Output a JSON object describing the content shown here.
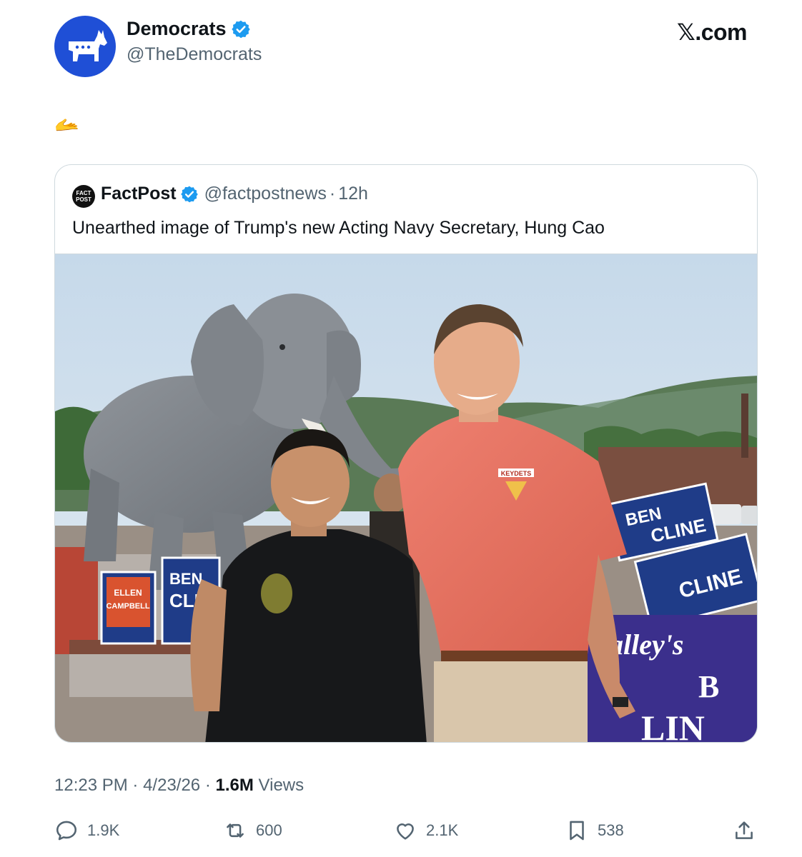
{
  "author": {
    "name": "Democrats",
    "handle": "@TheDemocrats",
    "verified": true,
    "avatar_icon": "donkey-logo",
    "avatar_color": "#1f4fd6"
  },
  "brand": "𝕏.com",
  "tweet_text": "🫴",
  "quote": {
    "logo_text_top": "FACT",
    "logo_text_bottom": "POST",
    "name": "FactPost",
    "handle": "@factpostnews",
    "separator": "·",
    "time": "12h",
    "text": "Unearthed image of Trump's new Acting Navy Secretary, Hung Cao",
    "photo_signs": {
      "left_sign_line1": "ELLEN",
      "left_sign_line2": "CAMPBELL",
      "mid_sign_line1": "BEN",
      "mid_sign_line2": "CLIN",
      "right_sign_line1": "BEN",
      "right_sign_line2": "CLINE",
      "right_sign_line3": "CLINE",
      "banner_line1": "alley's",
      "banner_line2": "B",
      "banner_line3": "LIN",
      "shirt_logo": "KEYDETS"
    }
  },
  "meta": {
    "time": "12:23 PM",
    "sep1": "·",
    "date": "4/23/26",
    "sep2": "·",
    "views_count": "1.6M",
    "views_label": "Views"
  },
  "actions": {
    "replies": "1.9K",
    "reposts": "600",
    "likes": "2.1K",
    "bookmarks": "538"
  },
  "colors": {
    "verified": "#1d9bf0",
    "muted_text": "#536471",
    "border": "#cfd9de"
  }
}
